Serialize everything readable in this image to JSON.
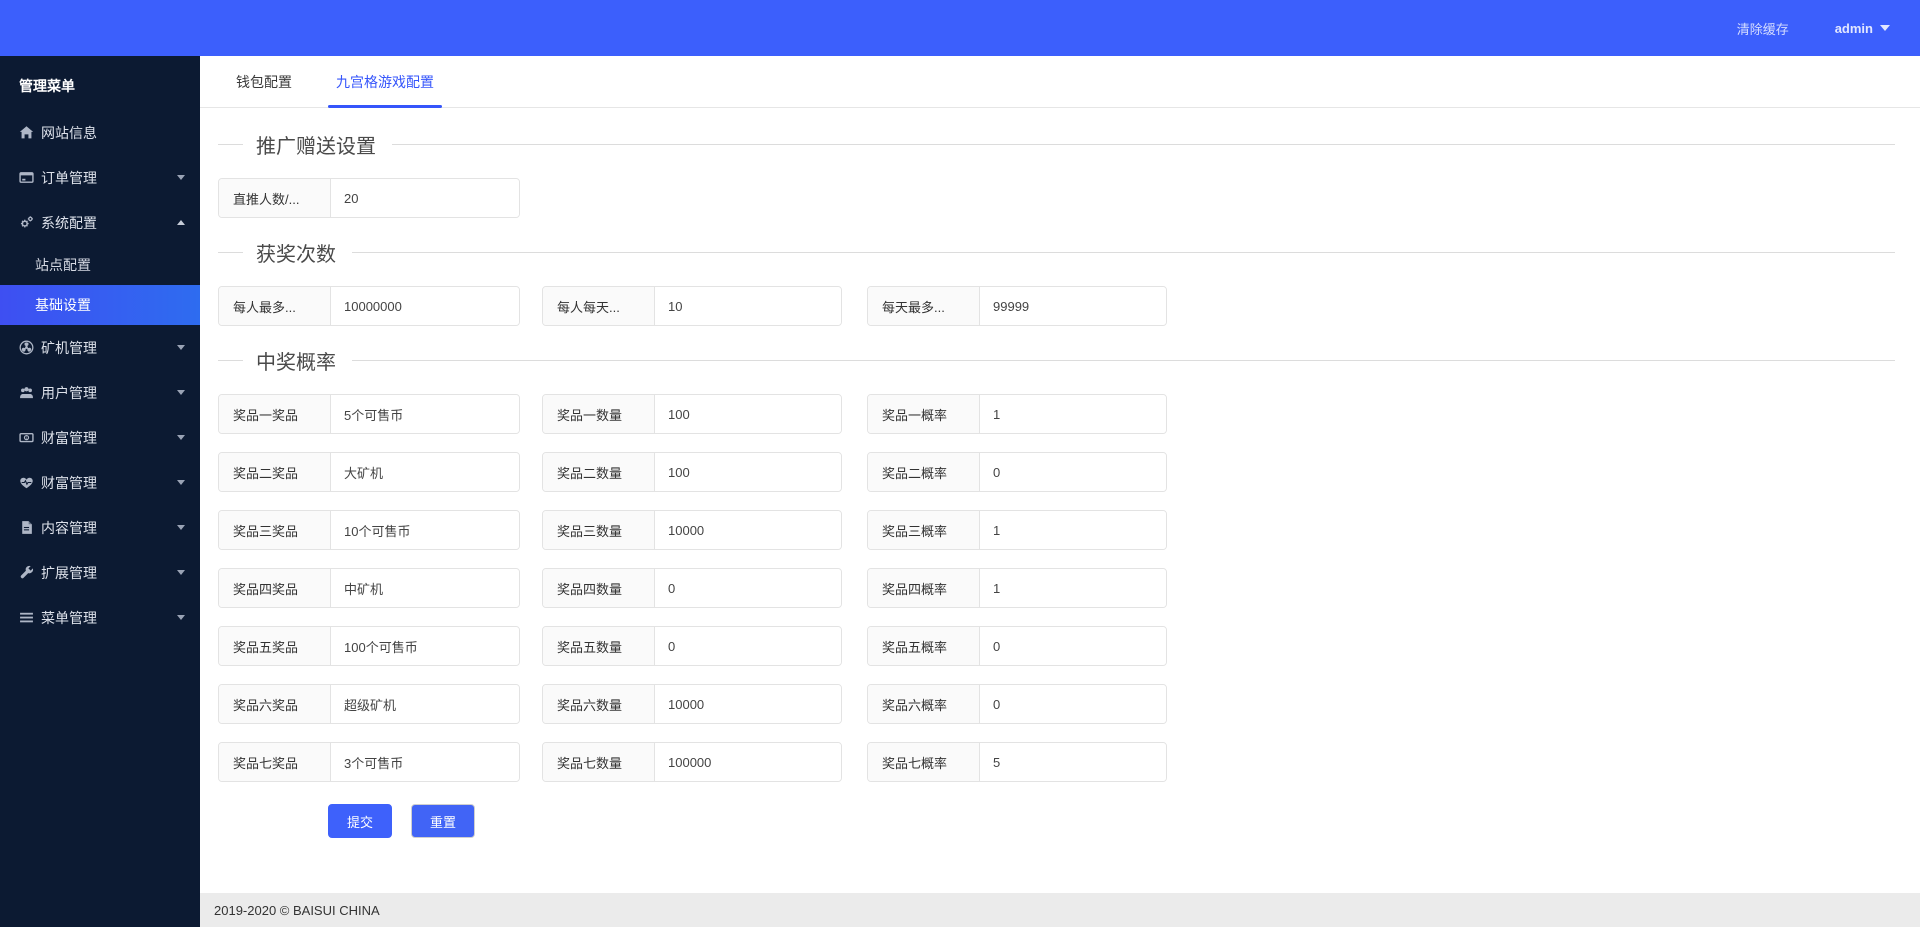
{
  "topbar": {
    "clear_cache": "清除缓存",
    "user": "admin"
  },
  "sidebar": {
    "header": "管理菜单",
    "items": [
      {
        "key": "website-info",
        "label": "网站信息",
        "icon": "home-icon",
        "caret": "none"
      },
      {
        "key": "order-mgmt",
        "label": "订单管理",
        "icon": "order-icon",
        "caret": "down"
      },
      {
        "key": "system-config",
        "label": "系统配置",
        "icon": "gears-icon",
        "caret": "up",
        "children": [
          {
            "key": "site-config",
            "label": "站点配置",
            "active": false
          },
          {
            "key": "basic-settings",
            "label": "基础设置",
            "active": true
          }
        ]
      },
      {
        "key": "miner-mgmt",
        "label": "矿机管理",
        "icon": "fan-icon",
        "caret": "down"
      },
      {
        "key": "user-mgmt",
        "label": "用户管理",
        "icon": "users-icon",
        "caret": "down"
      },
      {
        "key": "wealth-mgmt-1",
        "label": "财富管理",
        "icon": "money-icon",
        "caret": "down"
      },
      {
        "key": "wealth-mgmt-2",
        "label": "财富管理",
        "icon": "heart-icon",
        "caret": "down"
      },
      {
        "key": "content-mgmt",
        "label": "内容管理",
        "icon": "file-icon",
        "caret": "down"
      },
      {
        "key": "extension-mgmt",
        "label": "扩展管理",
        "icon": "wrench-icon",
        "caret": "down"
      },
      {
        "key": "menu-mgmt",
        "label": "菜单管理",
        "icon": "menu-icon",
        "caret": "down"
      }
    ]
  },
  "tabs": [
    {
      "key": "wallet-config",
      "label": "钱包配置",
      "active": false
    },
    {
      "key": "grid-game-config",
      "label": "九宫格游戏配置",
      "active": true
    }
  ],
  "sections": [
    {
      "title": "推广赠送设置",
      "rows": [
        [
          {
            "key": "direct-referrals",
            "label": "直推人数/...",
            "value": "20"
          }
        ]
      ]
    },
    {
      "title": "获奖次数",
      "rows": [
        [
          {
            "key": "max-per-person",
            "label": "每人最多...",
            "value": "10000000"
          },
          {
            "key": "per-person-daily",
            "label": "每人每天...",
            "value": "10"
          },
          {
            "key": "daily-max",
            "label": "每天最多...",
            "value": "99999"
          }
        ]
      ]
    },
    {
      "title": "中奖概率",
      "rows": [
        [
          {
            "key": "prize1-name",
            "label": "奖品一奖品",
            "value": "5个可售币"
          },
          {
            "key": "prize1-qty",
            "label": "奖品一数量",
            "value": "100"
          },
          {
            "key": "prize1-prob",
            "label": "奖品一概率",
            "value": "1"
          }
        ],
        [
          {
            "key": "prize2-name",
            "label": "奖品二奖品",
            "value": "大矿机"
          },
          {
            "key": "prize2-qty",
            "label": "奖品二数量",
            "value": "100"
          },
          {
            "key": "prize2-prob",
            "label": "奖品二概率",
            "value": "0"
          }
        ],
        [
          {
            "key": "prize3-name",
            "label": "奖品三奖品",
            "value": "10个可售币"
          },
          {
            "key": "prize3-qty",
            "label": "奖品三数量",
            "value": "10000"
          },
          {
            "key": "prize3-prob",
            "label": "奖品三概率",
            "value": "1"
          }
        ],
        [
          {
            "key": "prize4-name",
            "label": "奖品四奖品",
            "value": "中矿机"
          },
          {
            "key": "prize4-qty",
            "label": "奖品四数量",
            "value": "0"
          },
          {
            "key": "prize4-prob",
            "label": "奖品四概率",
            "value": "1"
          }
        ],
        [
          {
            "key": "prize5-name",
            "label": "奖品五奖品",
            "value": "100个可售币"
          },
          {
            "key": "prize5-qty",
            "label": "奖品五数量",
            "value": "0"
          },
          {
            "key": "prize5-prob",
            "label": "奖品五概率",
            "value": "0"
          }
        ],
        [
          {
            "key": "prize6-name",
            "label": "奖品六奖品",
            "value": "超级矿机"
          },
          {
            "key": "prize6-qty",
            "label": "奖品六数量",
            "value": "10000"
          },
          {
            "key": "prize6-prob",
            "label": "奖品六概率",
            "value": "0"
          }
        ],
        [
          {
            "key": "prize7-name",
            "label": "奖品七奖品",
            "value": "3个可售币"
          },
          {
            "key": "prize7-qty",
            "label": "奖品七数量",
            "value": "100000"
          },
          {
            "key": "prize7-prob",
            "label": "奖品七概率",
            "value": "5"
          }
        ]
      ]
    }
  ],
  "buttons": {
    "submit": "提交",
    "reset": "重置"
  },
  "footer": {
    "copyright": "2019-2020 © BAISUI CHINA"
  },
  "colors": {
    "accent": "#3c5ffc",
    "sidebar_bg": "#0c1a32",
    "active_item_gradient": "#3e4ff2 → #2e6cf0",
    "footer_bg": "#ebebeb"
  }
}
